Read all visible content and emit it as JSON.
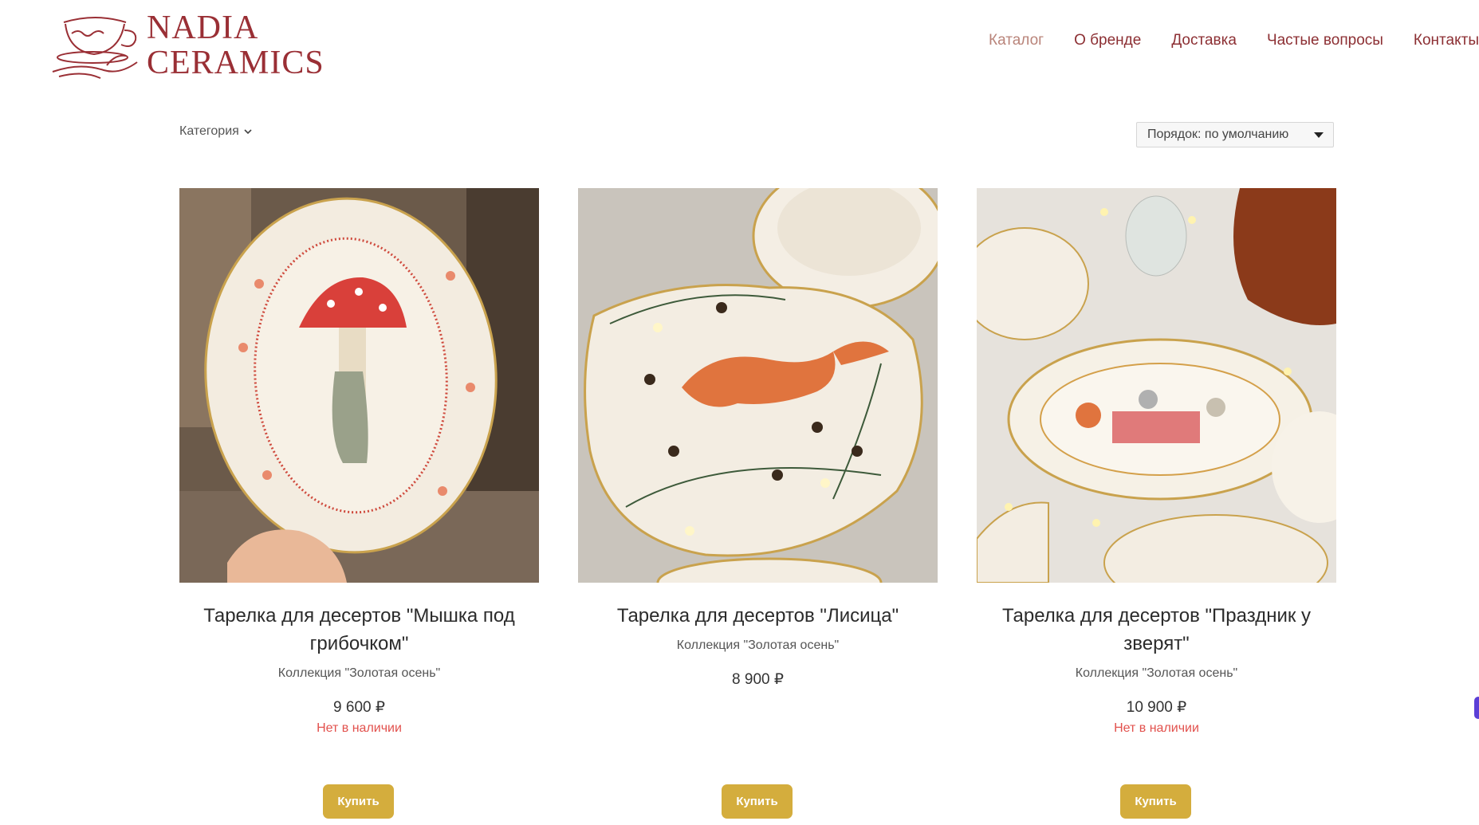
{
  "brand": {
    "line1": "NADIA",
    "line2": "CERAMICS",
    "color": "#9a2f35"
  },
  "nav": [
    {
      "label": "Каталог",
      "active": true
    },
    {
      "label": "О бренде"
    },
    {
      "label": "Доставка"
    },
    {
      "label": "Частые вопросы"
    },
    {
      "label": "Контакты"
    }
  ],
  "filters": {
    "category_label": "Категория",
    "sort_label": "Порядок: по умолчанию"
  },
  "products": [
    {
      "title": "Тарелка для десертов \"Мышка под грибочком\"",
      "collection": "Коллекция \"Золотая осень\"",
      "price": "9 600 ₽",
      "stock": "Нет в наличии",
      "buy": "Купить"
    },
    {
      "title": "Тарелка для десертов \"Лисица\"",
      "collection": "Коллекция \"Золотая осень\"",
      "price": "8 900 ₽",
      "stock": "",
      "buy": "Купить"
    },
    {
      "title": "Тарелка для десертов \"Праздник у зверят\"",
      "collection": "Коллекция \"Золотая осень\"",
      "price": "10 900 ₽",
      "stock": "Нет в наличии",
      "buy": "Купить"
    }
  ],
  "colors": {
    "accent_button": "#d4ad3d",
    "out_of_stock": "#e2514d",
    "nav_text": "#8c2f33",
    "nav_active": "#b9847a"
  }
}
